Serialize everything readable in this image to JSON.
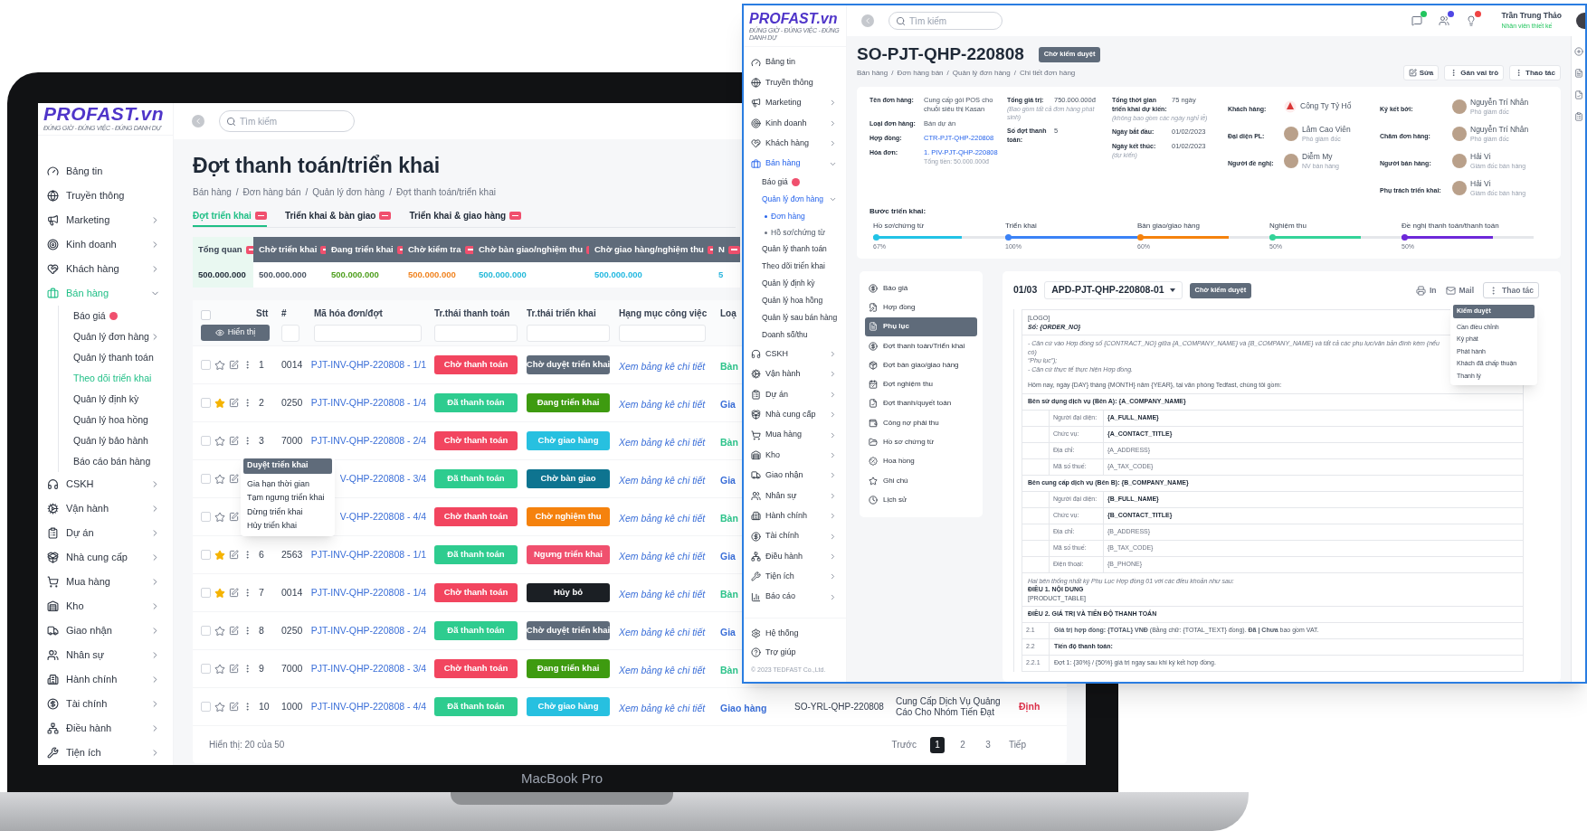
{
  "laptop_label": "MacBook Pro",
  "left": {
    "logo": {
      "name": "PROFAST.vn",
      "tagline": "ĐÚNG GIỜ - ĐÚNG VIỆC - ĐÚNG DANH DỰ"
    },
    "search": {
      "placeholder": "Tìm kiếm"
    },
    "sidebar": {
      "items": [
        {
          "label": "Bảng tin",
          "selected": false
        },
        {
          "label": "Truyền thông",
          "selected": false
        },
        {
          "label": "Marketing",
          "selected": false,
          "expanded": false
        },
        {
          "label": "Kinh doanh",
          "selected": false,
          "expanded": false
        },
        {
          "label": "Khách hàng",
          "selected": false,
          "expanded": false
        },
        {
          "label": "Bán hàng",
          "selected": true,
          "expanded": true,
          "children": [
            {
              "label": "Báo giá",
              "selected": false,
              "badge": true
            },
            {
              "label": "Quản lý đơn hàng",
              "selected": false,
              "badge": false,
              "expanded": false
            },
            {
              "label": "Quản lý thanh toán",
              "selected": false,
              "badge": false
            },
            {
              "label": "Theo dõi triển khai",
              "selected": true,
              "badge": false
            },
            {
              "label": "Quản lý định kỳ",
              "selected": false,
              "badge": false
            },
            {
              "label": "Quản lý hoa hồng",
              "selected": false,
              "badge": false
            },
            {
              "label": "Quản lý bảo hành",
              "selected": false,
              "badge": false
            },
            {
              "label": "Báo cáo bán hàng",
              "selected": false,
              "badge": false
            }
          ]
        },
        {
          "label": "CSKH",
          "selected": false,
          "expanded": false
        },
        {
          "label": "Vận hành",
          "selected": false,
          "expanded": false
        },
        {
          "label": "Dự án",
          "selected": false,
          "expanded": false
        },
        {
          "label": "Nhà cung cấp",
          "selected": false,
          "expanded": false
        },
        {
          "label": "Mua hàng",
          "selected": false,
          "expanded": false
        },
        {
          "label": "Kho",
          "selected": false,
          "expanded": false
        },
        {
          "label": "Giao nhận",
          "selected": false,
          "expanded": false
        },
        {
          "label": "Nhân sự",
          "selected": false,
          "expanded": false
        },
        {
          "label": "Hành chính",
          "selected": false,
          "expanded": false
        },
        {
          "label": "Tài chính",
          "selected": false,
          "expanded": false
        },
        {
          "label": "Điều hành",
          "selected": false,
          "expanded": false
        },
        {
          "label": "Tiện ích",
          "selected": false,
          "expanded": false
        }
      ]
    },
    "title": "Đợt thanh toán/triển khai",
    "breadcrumb": {
      "separator": "/",
      "items": [
        "Bán hàng",
        "Đơn hàng bán",
        "Quản lý đơn hàng",
        "Đợt thanh toán/triển khai"
      ]
    },
    "tabs": [
      {
        "label": "Đợt triển khai",
        "selected": true
      },
      {
        "label": "Triển khai & bàn giao",
        "selected": false
      },
      {
        "label": "Triển khai & giao hàng",
        "selected": false
      }
    ],
    "summary": [
      {
        "label": "Tổng quan",
        "value": "500.000.000",
        "selected": true,
        "color": "#1f2937"
      },
      {
        "label": "Chờ triển khai",
        "value": "500.000.000",
        "selected": false,
        "color": "#4b5563"
      },
      {
        "label": "Đang triển khai",
        "value": "500.000.000",
        "selected": false,
        "color": "#4d9e1c"
      },
      {
        "label": "Chờ kiểm tra",
        "value": "500.000.000",
        "selected": false,
        "color": "#f0821e"
      },
      {
        "label": "Chờ bàn giao/nghiệm thu",
        "value": "500.000.000",
        "selected": false,
        "color": "#22b8d8"
      },
      {
        "label": "Chờ giao hàng/nghiệm thu",
        "value": "500.000.000",
        "selected": false,
        "color": "#22b8e0"
      },
      {
        "label": "N",
        "value": "5",
        "selected": false,
        "color": "#2bb5dd"
      }
    ],
    "table": {
      "all_checked": false,
      "columns": [
        "Stt",
        "#",
        "Mã hóa đơn/đợt",
        "Tr.thái thanh toán",
        "Tr.thái triển khai",
        "Hạng mục công việc",
        "Loạ"
      ],
      "filter_button": "Hiển thị",
      "rows": [
        {
          "checked": false,
          "starred": false,
          "stt": "1",
          "number": "0014",
          "code": "PJT-INV-QHP-220808 - 1/1",
          "payment": {
            "label": "Chờ thanh toán",
            "color": "#f2455f"
          },
          "deploy": {
            "label": "Chờ duyệt triển khai",
            "color": "#5f6b7a"
          },
          "link": "Xem bảng kê chi tiết",
          "type": {
            "label": "Bàn",
            "color": "#2cc38a"
          }
        },
        {
          "checked": false,
          "starred": true,
          "stt": "2",
          "number": "0250",
          "code": "PJT-INV-QHP-220808 - 1/4",
          "payment": {
            "label": "Đã thanh toán",
            "color": "#2ecc8f"
          },
          "deploy": {
            "label": "Đang triển khai",
            "color": "#3e9b10"
          },
          "link": "Xem bảng kê chi tiết",
          "type": {
            "label": "Gia",
            "color": "#3b6fd8"
          }
        },
        {
          "checked": false,
          "starred": false,
          "stt": "3",
          "number": "7000",
          "code": "PJT-INV-QHP-220808 - 2/4",
          "payment": {
            "label": "Chờ thanh toán",
            "color": "#f2455f"
          },
          "deploy": {
            "label": "Chờ giao hàng",
            "color": "#27c0e0"
          },
          "link": "Xem bảng kê chi tiết",
          "type": {
            "label": "Bàn",
            "color": "#2cc38a"
          },
          "menu": [
            {
              "label": "Duyệt triển khai",
              "selected": true
            },
            {
              "label": "Gia hạn thời gian",
              "selected": false
            },
            {
              "label": "Tạm ngưng triển khai",
              "selected": false
            },
            {
              "label": "Dừng triển khai",
              "selected": false
            },
            {
              "label": "Hủy triển khai",
              "selected": false
            }
          ]
        },
        {
          "checked": false,
          "starred": false,
          "code": "V-QHP-220808 - 3/4",
          "payment": {
            "label": "Đã thanh toán",
            "color": "#2ecc8f"
          },
          "deploy": {
            "label": "Chờ bàn giao",
            "color": "#0e7490"
          },
          "link": "Xem bảng kê chi tiết",
          "type": {
            "label": "Gia",
            "color": "#3b6fd8"
          }
        },
        {
          "checked": false,
          "starred": false,
          "code": "V-QHP-220808 - 4/4",
          "payment": {
            "label": "Chờ thanh toán",
            "color": "#f2455f"
          },
          "deploy": {
            "label": "Chờ nghiệm thu",
            "color": "#f5820d"
          },
          "link": "Xem bảng kê chi tiết",
          "type": {
            "label": "Bàn",
            "color": "#2cc38a"
          }
        },
        {
          "checked": false,
          "starred": true,
          "stt": "6",
          "number": "2563",
          "code": "PJT-INV-QHP-220808 - 1/1",
          "payment": {
            "label": "Đã thanh toán",
            "color": "#2ecc8f"
          },
          "deploy": {
            "label": "Ngưng triển khai",
            "color": "#f0506e"
          },
          "link": "Xem bảng kê chi tiết",
          "type": {
            "label": "Gia",
            "color": "#3b6fd8"
          }
        },
        {
          "checked": false,
          "starred": true,
          "stt": "7",
          "number": "0014",
          "code": "PJT-INV-QHP-220808 - 1/4",
          "payment": {
            "label": "Chờ thanh toán",
            "color": "#f2455f"
          },
          "deploy": {
            "label": "Hủy bỏ",
            "color": "#1b1f24"
          },
          "link": "Xem bảng kê chi tiết",
          "type": {
            "label": "Bàn",
            "color": "#2cc38a"
          }
        },
        {
          "checked": false,
          "starred": false,
          "stt": "8",
          "number": "0250",
          "code": "PJT-INV-QHP-220808 - 2/4",
          "payment": {
            "label": "Đã thanh toán",
            "color": "#2ecc8f"
          },
          "deploy": {
            "label": "Chờ duyệt triển khai",
            "color": "#5f6b7a"
          },
          "link": "Xem bảng kê chi tiết",
          "type": {
            "label": "Gia",
            "color": "#3b6fd8"
          }
        },
        {
          "checked": false,
          "starred": false,
          "stt": "9",
          "number": "7000",
          "code": "PJT-INV-QHP-220808 - 3/4",
          "payment": {
            "label": "Chờ thanh toán",
            "color": "#f2455f"
          },
          "deploy": {
            "label": "Đang triển khai",
            "color": "#3e9b10"
          },
          "link": "Xem bảng kê chi tiết",
          "type": {
            "label": "Bàn",
            "color": "#2cc38a"
          }
        },
        {
          "checked": false,
          "starred": false,
          "stt": "10",
          "number": "1000",
          "code": "PJT-INV-QHP-220808 - 4/4",
          "payment": {
            "label": "Đã thanh toán",
            "color": "#2ecc8f"
          },
          "deploy": {
            "label": "Chờ giao hàng",
            "color": "#27c0e0"
          },
          "link": "Xem bảng kê chi tiết",
          "type": {
            "label": "Giao hàng",
            "color": "#3b6fd8"
          },
          "order": "SO-YRL-QHP-220808",
          "description": "Cung Cấp Dịch Vụ Quảng Cáo Cho Nhóm Tiến Đạt",
          "tag": {
            "label": "Định",
            "color": "#e0314b"
          }
        }
      ]
    },
    "footer": {
      "count": "Hiển thị: 20 của 50",
      "pager": [
        {
          "label": "Trước",
          "selected": false
        },
        {
          "label": "1",
          "selected": true
        },
        {
          "label": "2",
          "selected": false
        },
        {
          "label": "3",
          "selected": false
        },
        {
          "label": "Tiếp",
          "selected": false
        }
      ]
    }
  },
  "right": {
    "logo": {
      "name": "PROFAST.vn",
      "tagline": "ĐÚNG GIỜ - ĐÚNG VIỆC - ĐÚNG DANH DỰ"
    },
    "search": {
      "placeholder": "Tìm kiếm"
    },
    "notifications": [
      {
        "color": "#22c55e"
      },
      {
        "color": "#4f46e5"
      },
      {
        "color": "#ef4444"
      }
    ],
    "user": {
      "name": "Trần Trung Thảo",
      "role": "Nhân viên thiết kế"
    },
    "sidebar": {
      "items": [
        {
          "label": "Bảng tin",
          "selected": false
        },
        {
          "label": "Truyền thông",
          "selected": false
        },
        {
          "label": "Marketing",
          "selected": false,
          "expanded": false
        },
        {
          "label": "Kinh doanh",
          "selected": false,
          "expanded": false
        },
        {
          "label": "Khách hàng",
          "selected": false,
          "expanded": false
        },
        {
          "label": "Bán hàng",
          "selected": true,
          "expanded": true,
          "children": [
            {
              "label": "Báo giá",
              "selected": false,
              "badge": true
            },
            {
              "label": "Quản lý đơn hàng",
              "selected": true,
              "badge": false,
              "expanded": true,
              "children": [
                {
                  "label": "Đơn hàng",
                  "selected": true
                },
                {
                  "label": "Hồ sơ/chứng từ",
                  "selected": false
                }
              ]
            },
            {
              "label": "Quản lý thanh toán",
              "selected": false,
              "badge": false
            },
            {
              "label": "Theo dõi triển khai",
              "selected": false,
              "badge": false
            },
            {
              "label": "Quản lý định kỳ",
              "selected": false,
              "badge": false
            },
            {
              "label": "Quản lý hoa hồng",
              "selected": false,
              "badge": false
            },
            {
              "label": "Quản lý sau bán hàng",
              "selected": false,
              "badge": false
            },
            {
              "label": "Doanh số/thu",
              "selected": false,
              "badge": false
            }
          ]
        },
        {
          "label": "CSKH",
          "selected": false,
          "expanded": false
        },
        {
          "label": "Vận hành",
          "selected": false,
          "expanded": false
        },
        {
          "label": "Dự án",
          "selected": false,
          "expanded": false
        },
        {
          "label": "Nhà cung cấp",
          "selected": false,
          "expanded": false
        },
        {
          "label": "Mua hàng",
          "selected": false,
          "expanded": false
        },
        {
          "label": "Kho",
          "selected": false,
          "expanded": false
        },
        {
          "label": "Giao nhận",
          "selected": false,
          "expanded": false
        },
        {
          "label": "Nhân sự",
          "selected": false,
          "expanded": false
        },
        {
          "label": "Hành chính",
          "selected": false,
          "expanded": false
        },
        {
          "label": "Tài chính",
          "selected": false,
          "expanded": false
        },
        {
          "label": "Điều hành",
          "selected": false,
          "expanded": false
        },
        {
          "label": "Tiện ích",
          "selected": false,
          "expanded": false
        },
        {
          "label": "Báo cáo",
          "selected": false,
          "expanded": false
        }
      ],
      "bottom": [
        "Hệ thống",
        "Trợ giúp"
      ],
      "copyright": "© 2023 TEDFAST Co.,Ltd."
    },
    "title": "SO-PJT-QHP-220808",
    "status": "Chờ kiểm duyệt",
    "breadcrumb": {
      "separator": "/",
      "items": [
        "Bán hàng",
        "Đơn hàng bán",
        "Quản lý đơn hàng",
        "Chi tiết đơn hàng"
      ]
    },
    "actions": [
      "Sửa",
      "Gán vai trò",
      "Thao tác"
    ],
    "info": {
      "columns": [
        [
          {
            "kind": "text",
            "label": "Tên đơn hàng:",
            "value": "Cung cấp gói POS cho chuỗi siêu thị Kasan"
          },
          {
            "kind": "text",
            "label": "Loại đơn hàng:",
            "value": "Bán dự án"
          },
          {
            "kind": "link",
            "label": "Hợp đồng:",
            "value": "CTR-PJT-QHP-220808"
          },
          {
            "kind": "link",
            "label": "Hóa đơn:",
            "value": "1. PIV-PJT-QHP-220808",
            "note": "Tổng tiền: 50.000.000đ"
          }
        ],
        [
          {
            "kind": "text",
            "label": "Tổng giá trị:",
            "label_note": "(Bao gồm tất cả đơn hàng phát sinh)",
            "value": "750.000.000đ"
          },
          {
            "kind": "text",
            "label": "Số đợt thanh toán:",
            "value": "5"
          }
        ],
        [
          {
            "kind": "text",
            "label": "Tổng thời gian triển khai dự kiến:",
            "label_note": "(không bao gồm các ngày nghỉ lễ)",
            "value": "75 ngày"
          },
          {
            "kind": "text",
            "label": "Ngày bắt đầu:",
            "value": "01/02/2023"
          },
          {
            "kind": "text",
            "label": "Ngày kết thúc:",
            "label_note": "(dự kiến)",
            "value": "01/02/2023"
          }
        ],
        [
          {
            "kind": "company",
            "label": "Khách hàng:",
            "value": "Công Ty Tỷ Hổ"
          },
          {
            "kind": "person",
            "label": "Đại diện PL:",
            "value": "Lâm Cao Viên",
            "note": "Phó giám đốc"
          },
          {
            "kind": "person",
            "label": "Người đề nghị:",
            "value": "Diễm My",
            "note": "NV bán hàng"
          }
        ],
        [
          {
            "kind": "person",
            "label": "Ký kết bởi:",
            "value": "Nguyễn Trí Nhân",
            "note": "Phó giám đốc"
          },
          {
            "kind": "person",
            "label": "Chăm đơn hàng:",
            "value": "Nguyễn Trí Nhân",
            "note": "Phó giám đốc"
          },
          {
            "kind": "person",
            "label": "Người bán hàng:",
            "value": "Hải Vi",
            "note": "Giám đốc bán hàng"
          },
          {
            "kind": "person",
            "label": "Phụ trách triển khai:",
            "value": "Hải Vi",
            "note": "Giám đốc bán hàng"
          }
        ]
      ],
      "steps": {
        "title": "Bước triển khai:",
        "items": [
          {
            "label": "Hồ sơ/chứng từ",
            "reading": "67%",
            "level": 0.67,
            "color": "#22c3e6"
          },
          {
            "label": "Triển khai",
            "reading": "100%",
            "level": 1,
            "color": "#3b82f6"
          },
          {
            "label": "Bàn giao/giao hàng",
            "reading": "60%",
            "level": 0.69,
            "color": "#f5820d"
          },
          {
            "label": "Nghiệm thu",
            "reading": "50%",
            "level": 0.69,
            "color": "#34d399"
          },
          {
            "label": "Đề nghị thanh toán/thanh toán",
            "reading": "50%",
            "level": 0.69,
            "color": "#6d28d9"
          }
        ]
      }
    },
    "doc_menu": [
      {
        "label": "Báo giá",
        "selected": false
      },
      {
        "label": "Hợp đồng",
        "selected": false
      },
      {
        "label": "Phụ lục",
        "selected": true
      },
      {
        "label": "Đợt thanh toán/Triển khai",
        "selected": false
      },
      {
        "label": "Đợt bàn giao/giao hàng",
        "selected": false
      },
      {
        "label": "Đợt nghiệm thu",
        "selected": false
      },
      {
        "label": "Đợt thanh/quyết toán",
        "selected": false
      },
      {
        "label": "Công nợ phải thu",
        "selected": false
      },
      {
        "label": "Hồ sơ chứng từ",
        "selected": false
      },
      {
        "label": "Hoa hồng",
        "selected": false
      },
      {
        "label": "Ghi chú",
        "selected": false
      },
      {
        "label": "Lịch sử",
        "selected": false
      }
    ],
    "document": {
      "index": "01/03",
      "code": "APD-PJT-QHP-220808-01",
      "status": "Chờ kiểm duyệt",
      "actions": [
        "In",
        "Mail",
        "Thao tác"
      ],
      "menu": [
        {
          "label": "Kiểm duyệt",
          "selected": true
        },
        {
          "label": "Cần điều chỉnh",
          "selected": false
        },
        {
          "label": "Ký phát",
          "selected": false
        },
        {
          "label": "Phát hành",
          "selected": false
        },
        {
          "label": "Khách đã chấp thuận",
          "selected": false
        },
        {
          "label": "Thanh lý",
          "selected": false
        }
      ],
      "body": [
        {
          "kind": "note",
          "divider": false,
          "lines": [
            {
              "kind": "text",
              "text": "[LOGO]"
            },
            {
              "kind": "reference",
              "text": "Số: {ORDER_NO}"
            }
          ]
        },
        {
          "kind": "note",
          "divider": true,
          "lines": [
            {
              "kind": "remark",
              "text": "- Căn cứ vào Hợp đồng số {CONTRACT_NO} giữa {A_COMPANY_NAME} và {B_COMPANY_NAME} và tất cả các phụ lục/văn bản đính kèm (nếu có)"
            },
            {
              "kind": "remark",
              "text": "“Phụ lục”);"
            },
            {
              "kind": "remark",
              "text": "- Căn cứ thực tế thực hiện Hợp đồng."
            }
          ]
        },
        {
          "kind": "note",
          "divider": false,
          "lines": [
            {
              "kind": "text",
              "text": "Hôm nay, ngày {DAY} tháng {MONTH} năm {YEAR}, tại văn phòng Tedfast, chúng tôi gồm:"
            }
          ]
        },
        {
          "kind": "section",
          "text": "Bên sử dụng dịch vụ (Bên A): {A_COMPANY_NAME}"
        },
        {
          "kind": "field",
          "label": "Người đại diện:",
          "value": "{A_FULL_NAME}",
          "bold": true
        },
        {
          "kind": "field",
          "label": "Chức vụ:",
          "value": "{A_CONTACT_TITLE}",
          "bold": true
        },
        {
          "kind": "field",
          "label": "Địa chỉ:",
          "value": "{A_ADDRESS}",
          "bold": false
        },
        {
          "kind": "field",
          "label": "Mã số thuế:",
          "value": "{A_TAX_CODE}",
          "bold": false
        },
        {
          "kind": "section",
          "text": "Bên cung cấp dịch vụ (Bên B): {B_COMPANY_NAME}"
        },
        {
          "kind": "field",
          "label": "Người đại diện:",
          "value": "{B_FULL_NAME}",
          "bold": true
        },
        {
          "kind": "field",
          "label": "Chức vụ:",
          "value": "{B_CONTACT_TITLE}",
          "bold": true
        },
        {
          "kind": "field",
          "label": "Địa chỉ:",
          "value": "{B_ADDRESS}",
          "bold": false
        },
        {
          "kind": "field",
          "label": "Mã số thuế:",
          "value": "{B_TAX_CODE}",
          "bold": false
        },
        {
          "kind": "field",
          "label": "Điện thoại:",
          "value": "{B_PHONE}",
          "bold": false
        },
        {
          "kind": "note",
          "divider": true,
          "lines": [
            {
              "kind": "remark",
              "text": "Hai bên thống nhất ký Phụ Lục Hợp đồng 01 với các điều khoản như sau:"
            },
            {
              "kind": "heading",
              "text": "ĐIỀU 1. NỘI DUNG"
            },
            {
              "kind": "text",
              "text": "[PRODUCT_TABLE]"
            }
          ]
        },
        {
          "kind": "section",
          "text": "ĐIỀU 2. GIÁ TRỊ VÀ TIẾN ĐỘ THANH TOÁN"
        },
        {
          "kind": "clause",
          "number": "2.1",
          "text": "**Giá trị hợp đồng: {TOTAL} VNĐ** (Bằng chữ: {TOTAL_TEXT} đồng). **Đã | Chưa** bao gồm VAT.",
          "bold": false
        },
        {
          "kind": "clause",
          "number": "2.2",
          "text": "Tiến độ thanh toán:",
          "bold": true
        },
        {
          "kind": "clause",
          "number": "2.2.1",
          "text": "Đợt 1: {30%} / {50%} giá trị ngay sau khi ký kết hợp đồng.",
          "bold": false
        }
      ]
    }
  }
}
